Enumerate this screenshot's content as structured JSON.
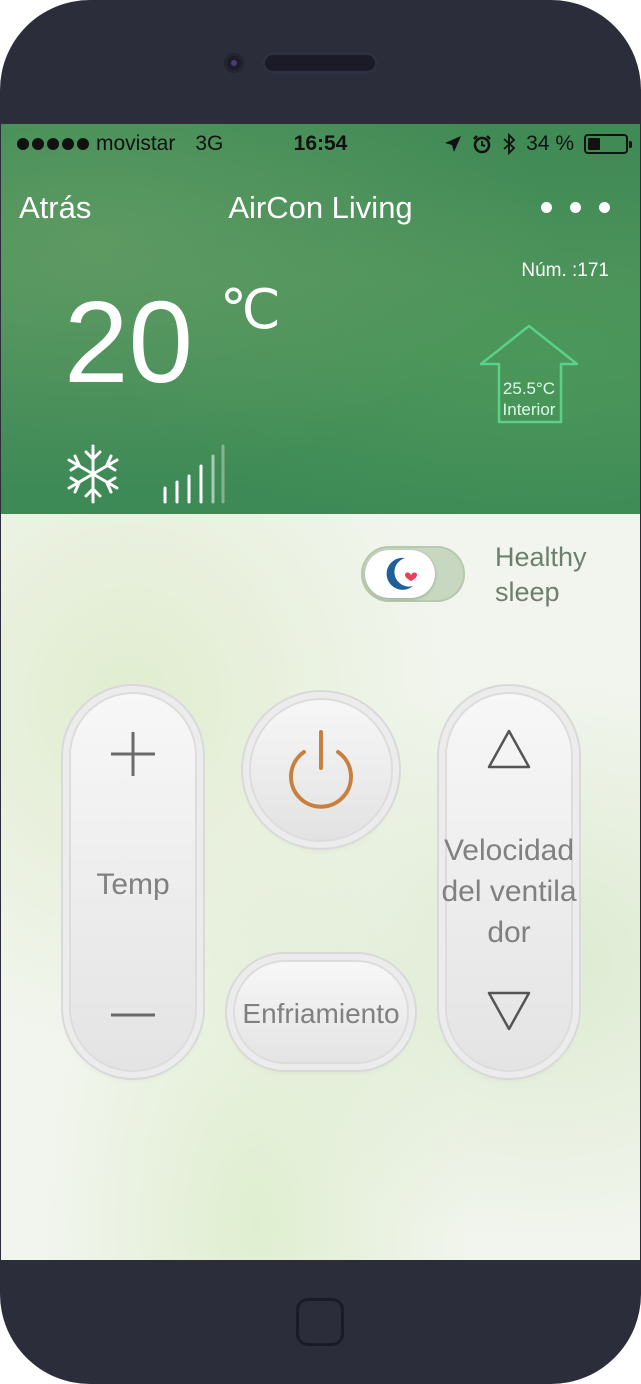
{
  "status_bar": {
    "carrier": "movistar",
    "network": "3G",
    "time": "16:54",
    "battery": "34 %",
    "battery_level": 0.34,
    "icons": [
      "location-arrow-icon",
      "alarm-clock-icon",
      "bluetooth-icon",
      "battery-icon"
    ]
  },
  "nav": {
    "back_label": "Atrás",
    "title": "AirCon Living",
    "more_icon": "more-dots-icon"
  },
  "device": {
    "number_label": "Núm. :171",
    "set_temperature": "20",
    "unit": "℃",
    "indoor_temperature": "25.5°C",
    "indoor_label": "Interior",
    "mode_icon": "snowflake-icon",
    "fan_icon": "fan-speed-bars-icon"
  },
  "healthy_sleep": {
    "label": "Healthy sleep",
    "icon": "moon-heart-icon",
    "enabled": false
  },
  "controls": {
    "temp_label": "Temp",
    "power_icon": "power-icon",
    "mode_label": "Enfriamiento",
    "fan_label": "Velocidad del ventilador",
    "plus_icon": "plus-icon",
    "minus_icon": "minus-icon",
    "up_icon": "triangle-up-icon",
    "down_icon": "triangle-down-icon",
    "power_color": "#c8803f"
  },
  "colors": {
    "header_green": "#3f8a55",
    "indoor_outline": "#5ad08a",
    "heart": "#e8405a",
    "moon": "#1f5f9a"
  }
}
